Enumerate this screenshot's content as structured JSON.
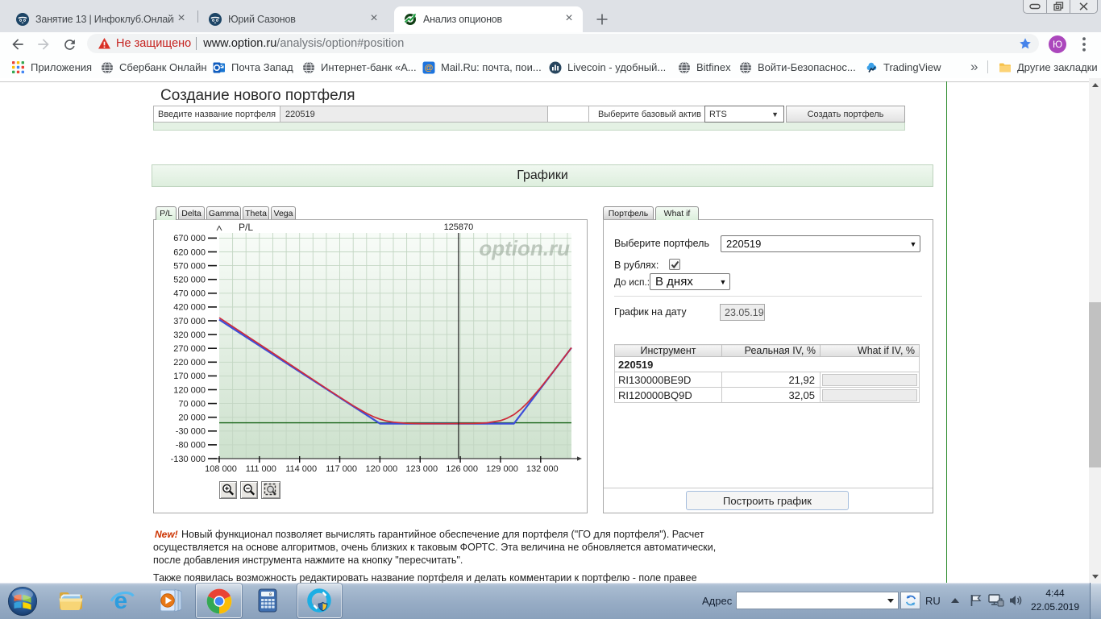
{
  "browser": {
    "tabs": [
      {
        "title": "Занятие 13 | Инфоклуб.Онлайн"
      },
      {
        "title": "Юрий Сазонов"
      },
      {
        "title": "Анализ опционов"
      }
    ],
    "security_warning": "Не защищено",
    "url_host": "www.option.ru",
    "url_path": "/analysis/option#position",
    "avatar_initial": "Ю",
    "bookmarks": [
      "Приложения",
      "Сбербанк Онлайн",
      "Почта Запад",
      "Интернет-банк «А...",
      "Mail.Ru: почта, пои...",
      "Livecoin - удобный...",
      "Bitfinex",
      "Войти-Безопаснос...",
      "TradingView"
    ],
    "bookmarks_overflow": "»",
    "other_bookmarks_label": "Другие закладки"
  },
  "page": {
    "heading": "Создание нового портфеля",
    "form": {
      "name_label": "Введите название портфеля",
      "name_value": "220519",
      "asset_label": "Выберите базовый актив",
      "asset_value": "RTS",
      "submit_label": "Создать портфель"
    },
    "section_title": "Графики",
    "chart_tabs": [
      "P/L",
      "Delta",
      "Gamma",
      "Theta",
      "Vega"
    ],
    "right_tabs": [
      "Портфель",
      "What if"
    ],
    "whatif": {
      "portfolio_label": "Выберите портфель",
      "portfolio_value": "220519",
      "rubles_label": "В рублях:",
      "until_label": "До исп.:",
      "until_value": "В днях",
      "date_label": "График на дату",
      "date_value": "23.05.19",
      "table": {
        "headers": [
          "Инструмент",
          "Реальная IV, %",
          "What if IV, %"
        ],
        "group_row": "220519",
        "rows": [
          {
            "instrument": "RI130000BE9D",
            "real_iv": "21,92",
            "whatif_iv": ""
          },
          {
            "instrument": "RI120000BQ9D",
            "real_iv": "32,05",
            "whatif_iv": ""
          }
        ]
      },
      "submit_label": "Построить график"
    },
    "notes": {
      "badge": "New!",
      "paragraph1_lines": [
        "Новый функционал позволяет вычислять гарантийное обеспечение для портфеля (\"ГО для портфеля\"). Расчет",
        "осуществляется на основе алгоритмов, очень близких к таковым ФОРТС. Эта величина не обновляется автоматически,",
        "после добавления инструмента нажмите на кнопку \"пересчитать\"."
      ],
      "paragraph2": "Также появилась возможность редактировать название портфеля и делать комментарии к портфелю - поле правее"
    }
  },
  "chart_data": {
    "type": "line",
    "title": "P/L",
    "watermark": "option.ru",
    "xlim": [
      108000,
      134300
    ],
    "ylim": [
      -130000,
      688700
    ],
    "x_grid_step": 1000,
    "y_grid_step": 50000,
    "x_ticks": [
      {
        "v": 108000,
        "label": "108 000"
      },
      {
        "v": 111000,
        "label": "111 000"
      },
      {
        "v": 114000,
        "label": "114 000"
      },
      {
        "v": 117000,
        "label": "117 000"
      },
      {
        "v": 120000,
        "label": "120 000"
      },
      {
        "v": 123000,
        "label": "123 000"
      },
      {
        "v": 126000,
        "label": "126 000"
      },
      {
        "v": 129000,
        "label": "129 000"
      },
      {
        "v": 132000,
        "label": "132 000"
      }
    ],
    "y_ticks": [
      {
        "v": 670000,
        "label": "670 000"
      },
      {
        "v": 620000,
        "label": "620 000"
      },
      {
        "v": 570000,
        "label": "570 000"
      },
      {
        "v": 520000,
        "label": "520 000"
      },
      {
        "v": 470000,
        "label": "470 000"
      },
      {
        "v": 420000,
        "label": "420 000"
      },
      {
        "v": 370000,
        "label": "370 000"
      },
      {
        "v": 320000,
        "label": "320 000"
      },
      {
        "v": 270000,
        "label": "270 000"
      },
      {
        "v": 220000,
        "label": "220 000"
      },
      {
        "v": 170000,
        "label": "170 000"
      },
      {
        "v": 120000,
        "label": "120 000"
      },
      {
        "v": 70000,
        "label": "70 000"
      },
      {
        "v": 20000,
        "label": "20 000"
      },
      {
        "v": -30000,
        "label": "-30 000"
      },
      {
        "v": -80000,
        "label": "-80 000"
      },
      {
        "v": -130000,
        "label": "-130 000"
      }
    ],
    "price_line": {
      "x": 125870,
      "label": "125870"
    },
    "zero_line_value": 0,
    "series": [
      {
        "name": "expiration-payoff",
        "color": "#3d4ed8",
        "width": 2.2,
        "points": [
          [
            108000,
            374000
          ],
          [
            120000,
            -3000
          ],
          [
            130000,
            -3000
          ],
          [
            134300,
            272000
          ]
        ]
      },
      {
        "name": "current-value",
        "color": "#ce2b3a",
        "width": 1.7,
        "points": [
          [
            108000,
            381100
          ],
          [
            110000,
            317000
          ],
          [
            112000,
            252900
          ],
          [
            114000,
            188800
          ],
          [
            116000,
            124700
          ],
          [
            117000,
            93060
          ],
          [
            118000,
            62200
          ],
          [
            119000,
            34060
          ],
          [
            119500,
            22400
          ],
          [
            120000,
            12880
          ],
          [
            120500,
            6380
          ],
          [
            121000,
            2020
          ],
          [
            122000,
            -1910
          ],
          [
            123000,
            -3075
          ],
          [
            124000,
            -3400
          ],
          [
            125000,
            -3450
          ],
          [
            126000,
            -2850
          ],
          [
            127000,
            -2640
          ],
          [
            128000,
            -274
          ],
          [
            129000,
            7719
          ],
          [
            129500,
            16570
          ],
          [
            130000,
            29774
          ],
          [
            130500,
            48600
          ],
          [
            131000,
            71700
          ],
          [
            132000,
            127764
          ],
          [
            133000,
            189332
          ],
          [
            134300,
            272340
          ]
        ]
      }
    ],
    "colors": {
      "plot_top": "#f8fcf8",
      "plot_bottom": "#cde1cd",
      "grid": "#c3d6c3",
      "zero_line": "#156315",
      "price_line": "#1c1c1c",
      "axis": "#3a3a3a",
      "tick_text": "#222222",
      "watermark": "#9dab9d"
    }
  },
  "taskbar": {
    "address_label": "Адрес",
    "language": "RU",
    "time": "4:44",
    "date": "22.05.2019",
    "apps": [
      "start",
      "explorer",
      "internet-explorer",
      "media-player",
      "chrome",
      "calculator",
      "option-app"
    ]
  }
}
